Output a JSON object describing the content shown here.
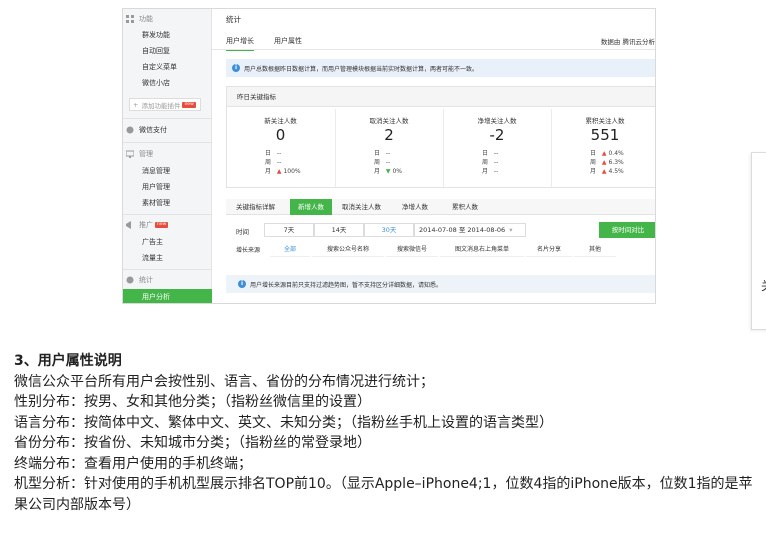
{
  "sidebar": {
    "sections": [
      {
        "title": "功能",
        "items": [
          "群发功能",
          "自动回复",
          "自定义菜单",
          "微信小店"
        ]
      },
      {
        "title": "微信支付",
        "items": []
      },
      {
        "title": "管理",
        "items": [
          "消息管理",
          "用户管理",
          "素材管理"
        ]
      },
      {
        "title": "推广",
        "badge": "new",
        "items": [
          "广告主",
          "流量主"
        ]
      },
      {
        "title": "统计",
        "items": [
          "用户分析"
        ]
      }
    ],
    "add_plugin": "添加功能插件",
    "add_plugin_badge": "new"
  },
  "main": {
    "title": "统计",
    "tabs": [
      "用户增长",
      "用户属性"
    ],
    "top_right": "数据由 腾讯云分析",
    "notice": "用户总数根据昨日数据计算，而用户管理模块根据当前实时数据计算，两者可能不一致。",
    "panel_title": "昨日关键指标",
    "kpis": [
      {
        "label": "新关注人数",
        "value": "0",
        "day": "--",
        "week": "--",
        "month": "100%",
        "month_dir": "up"
      },
      {
        "label": "取消关注人数",
        "value": "2",
        "day": "--",
        "week": "--",
        "month": "0%",
        "month_dir": "down"
      },
      {
        "label": "净增关注人数",
        "value": "-2",
        "day": "--",
        "week": "--",
        "month": "--"
      },
      {
        "label": "累积关注人数",
        "value": "551",
        "day": "0.4%",
        "week": "6.3%",
        "month": "4.5%",
        "dir": "up"
      }
    ],
    "row_labels": {
      "day": "日",
      "week": "周",
      "month": "月"
    },
    "subtabs": [
      "关键指标详解",
      "新增人数",
      "取消关注人数",
      "净增人数",
      "累积人数"
    ],
    "time_label": "时间",
    "time_options": [
      "7天",
      "14天",
      "30天"
    ],
    "date_range": "2014-07-08 至 2014-08-06",
    "compare_button": "按时间对比",
    "source_label": "增长来源",
    "sources": [
      "全部",
      "搜索公众号名称",
      "搜索微信号",
      "图文消息右上角菜单",
      "名片分享",
      "其他"
    ],
    "notice2": "用户增长来源目前只支持过滤趋势图，暂不支持区分详细数据，请知悉。"
  },
  "edge_glyphs": [
    "关",
    "「"
  ],
  "article": {
    "heading": "3、用户属性说明",
    "lines": [
      "微信公众平台所有用户会按性别、语言、省份的分布情况进行统计；",
      "性别分布：按男、女和其他分类；（指粉丝微信里的设置）",
      "语言分布：按简体中文、繁体中文、英文、未知分类；（指粉丝手机上设置的语言类型）",
      "省份分布：按省份、未知城市分类；（指粉丝的常登录地）",
      "终端分布：查看用户使用的手机终端；",
      "机型分析：针对使用的手机机型展示排名TOP前10。（显示Apple–iPhone4;1，位数4指的iPhone版本，位数1指的是苹果公司内部版本号）"
    ]
  }
}
